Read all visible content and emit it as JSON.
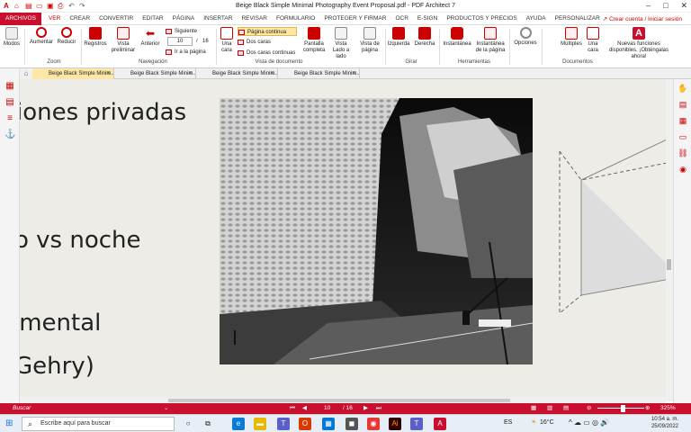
{
  "window": {
    "title": "Beige Black Simple Minimal Photography Event Proposal.pdf  -  PDF Architect 7",
    "controls": [
      "–",
      "□",
      "✕"
    ]
  },
  "menu": {
    "tabs": [
      "ARCHIVOS",
      "VER",
      "CREAR",
      "CONVERTIR",
      "EDITAR",
      "PÁGINA",
      "INSERTAR",
      "REVISAR",
      "FORMULARIO",
      "PROTEGER Y FIRMAR",
      "OCR",
      "E-SIGN",
      "PRODUCTOS Y PRECIOS",
      "AYUDA",
      "PERSONALIZAR"
    ],
    "active_tab": "VER",
    "account_link": "Crear cuenta / Iniciar sesión"
  },
  "ribbon": {
    "modos": "Modos",
    "zoom": {
      "aumentar": "Aumentar",
      "reducir": "Reducir",
      "group": "Zoom"
    },
    "navegacion": {
      "registros": "Registros",
      "vista_preliminar": "Vista preliminar",
      "anterior": "Anterior",
      "siguiente": "Siguiente",
      "current_page": "10",
      "total_pages": "16",
      "page_sep": "/",
      "ir_a_pagina": "Ir a la página",
      "group": "Navegación"
    },
    "vista": {
      "una_cara": "Una cara",
      "pagina_continua": "Página continua",
      "dos_caras": "Dos caras",
      "dos_caras_continuas": "Dos caras continuas",
      "pantalla_completa": "Pantalla completa",
      "vista_lado_a_lado": "Vista Lado a lado",
      "vista_de_pagina": "Vista de página",
      "group": "Vista de documento"
    },
    "girar": {
      "izquierda": "Izquierda",
      "derecha": "Derecha",
      "group": "Girar"
    },
    "herramientas": {
      "instantanea": "Instantánea",
      "instantanea_pagina": "Instantánea de la página",
      "group": "Herramientas"
    },
    "opciones": "Opciones",
    "documentos": {
      "multiples": "Múltiples",
      "una_cara": "Una cara",
      "nuevas": "Nuevas funciones disponibles. ¡Obténgalas ahora!",
      "group": "Documentos"
    }
  },
  "doc_tabs": [
    {
      "label": "Beige Black Simple Minim...",
      "active": true
    },
    {
      "label": "Beige Black Simple Minim...",
      "active": false
    },
    {
      "label": "Beige Black Simple Minim...",
      "active": false
    },
    {
      "label": "Beige Black Simple Minim...",
      "active": false
    }
  ],
  "document": {
    "lines": [
      "iones privadas",
      "o vs noche",
      "imental",
      "Gehry)"
    ]
  },
  "statusbar": {
    "search": "Buscar",
    "page": "10",
    "total": "/ 16",
    "zoom": "325%"
  },
  "taskbar": {
    "search_placeholder": "Escribe aquí para buscar",
    "language": "ES",
    "temperature": "16°C",
    "time": "10:54 a. m.",
    "date": "25/09/2022"
  },
  "colors": {
    "accent": "#c8102e",
    "highlight": "#fde7a6",
    "canvas": "#edece7"
  }
}
